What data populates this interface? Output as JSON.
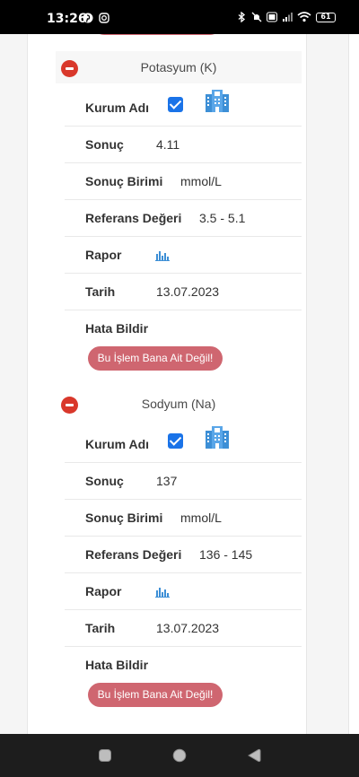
{
  "status_bar": {
    "time": "13:26",
    "battery": "61"
  },
  "cards": [
    {
      "title": "Potasyum (K)",
      "kurum_label": "Kurum Adı",
      "sonuc_label": "Sonuç",
      "sonuc_value": "4.11",
      "birim_label": "Sonuç Birimi",
      "birim_value": "mmol/L",
      "referans_label": "Referans Değeri",
      "referans_value": "3.5 - 5.1",
      "rapor_label": "Rapor",
      "tarih_label": "Tarih",
      "tarih_value": "13.07.2023",
      "hata_label": "Hata Bildir",
      "hata_button": "Bu İşlem Bana Ait Değil!"
    },
    {
      "title": "Sodyum (Na)",
      "kurum_label": "Kurum Adı",
      "sonuc_label": "Sonuç",
      "sonuc_value": "137",
      "birim_label": "Sonuç Birimi",
      "birim_value": "mmol/L",
      "referans_label": "Referans Değeri",
      "referans_value": "136 - 145",
      "rapor_label": "Rapor",
      "tarih_label": "Tarih",
      "tarih_value": "13.07.2023",
      "hata_label": "Hata Bildir",
      "hata_button": "Bu İşlem Bana Ait Değil!"
    }
  ],
  "colors": {
    "danger_button": "#cf6670",
    "collapse": "#d9382b",
    "checkbox": "#1a73e8",
    "icon_blue": "#3d8fd6"
  }
}
